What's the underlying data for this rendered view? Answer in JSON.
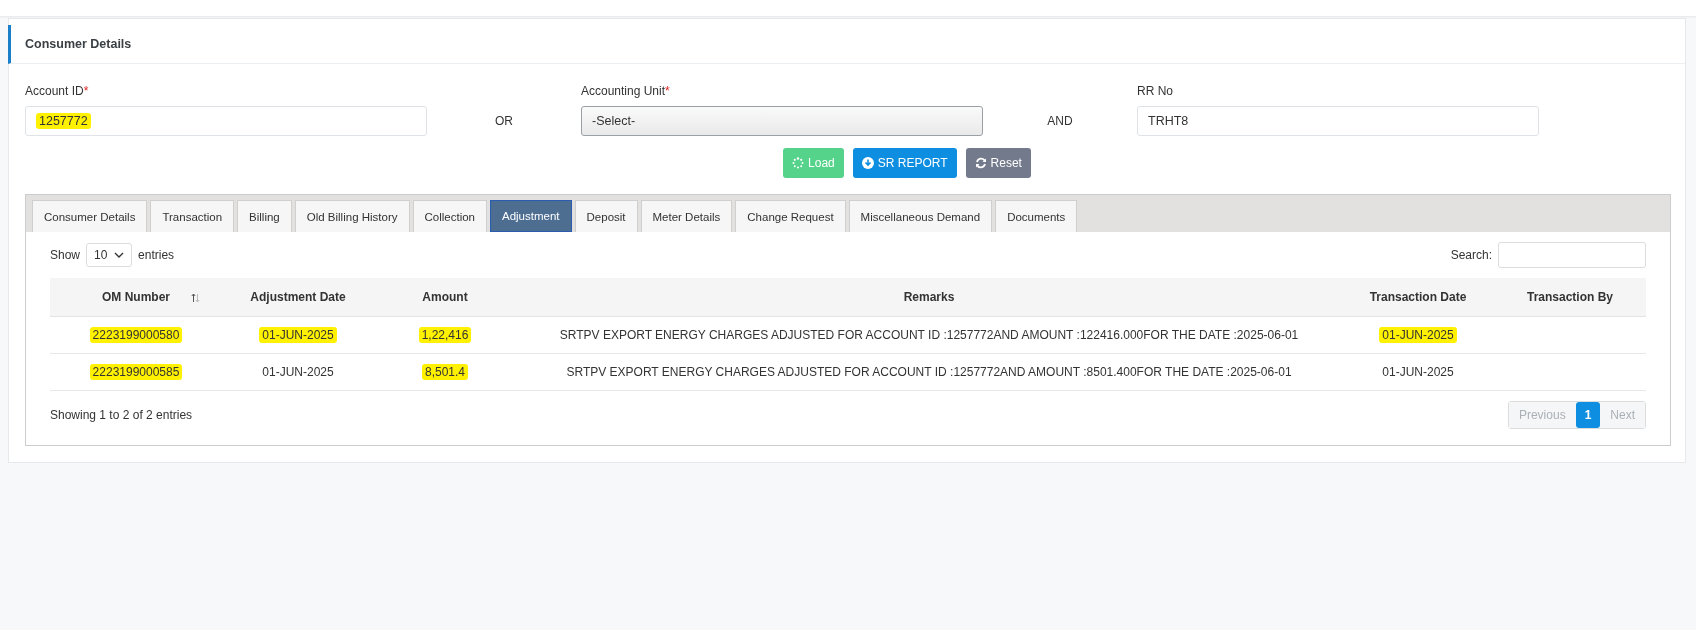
{
  "panel": {
    "title": "Consumer Details"
  },
  "fields": [
    {
      "label": "Account ID",
      "required_mark": "*",
      "kind": "input",
      "value": "1257772",
      "highlighted": true
    },
    {
      "separator": "OR"
    },
    {
      "label": "Accounting Unit",
      "required_mark": "*",
      "kind": "select",
      "value": "-Select-",
      "highlighted": false
    },
    {
      "separator": "AND"
    },
    {
      "label": "RR No",
      "kind": "input",
      "value": "TRHT8",
      "highlighted": false
    }
  ],
  "buttons": [
    {
      "label": "Load",
      "kind": "load"
    },
    {
      "label": "SR REPORT",
      "kind": "report"
    },
    {
      "label": "Reset",
      "kind": "reset"
    }
  ],
  "tabs": [
    {
      "label": "Consumer Details",
      "selected": false
    },
    {
      "label": "Transaction",
      "selected": false
    },
    {
      "label": "Billing",
      "selected": false
    },
    {
      "label": "Old Billing History",
      "selected": false
    },
    {
      "label": "Collection",
      "selected": false
    },
    {
      "label": "Adjustment",
      "selected": true
    },
    {
      "label": "Deposit",
      "selected": false
    },
    {
      "label": "Meter Details",
      "selected": false
    },
    {
      "label": "Change Request",
      "selected": false
    },
    {
      "label": "Miscellaneous Demand",
      "selected": false
    },
    {
      "label": "Documents",
      "selected": false
    }
  ],
  "length_menu": {
    "before": "Show",
    "value": "10",
    "after": "entries"
  },
  "search": {
    "label": "Search:"
  },
  "table": {
    "columns": [
      {
        "label": "OM Number",
        "sortable": true
      },
      {
        "label": "Adjustment Date",
        "sortable": false
      },
      {
        "label": "Amount",
        "sortable": false
      },
      {
        "label": "Remarks",
        "sortable": false
      },
      {
        "label": "Transaction Date",
        "sortable": false
      },
      {
        "label": "Transaction By",
        "sortable": false
      }
    ],
    "rows": [
      {
        "cells": [
          {
            "text": "2223199000580",
            "highlighted": true
          },
          {
            "text": "01-JUN-2025",
            "highlighted": true
          },
          {
            "text": "1,22,416",
            "highlighted": true
          },
          {
            "text": "SRTPV EXPORT ENERGY CHARGES ADJUSTED FOR ACCOUNT ID :1257772AND AMOUNT :122416.000FOR THE DATE :2025-06-01",
            "highlighted": false
          },
          {
            "text": "01-JUN-2025",
            "highlighted": true
          }
        ]
      },
      {
        "cells": [
          {
            "text": "2223199000585",
            "highlighted": true
          },
          {
            "text": "01-JUN-2025",
            "highlighted": false
          },
          {
            "text": "8,501.4",
            "highlighted": true
          },
          {
            "text": "SRTPV EXPORT ENERGY CHARGES ADJUSTED FOR ACCOUNT ID :1257772AND AMOUNT :8501.400FOR THE DATE :2025-06-01",
            "highlighted": false
          },
          {
            "text": "01-JUN-2025",
            "highlighted": false
          }
        ]
      }
    ]
  },
  "info": "Showing 1 to 2 of 2 entries",
  "pagination": [
    {
      "label": "Previous",
      "kind": "nav",
      "selected": false,
      "disabled": true
    },
    {
      "label": "1",
      "kind": "page",
      "selected": true,
      "disabled": false
    },
    {
      "label": "Next",
      "kind": "nav",
      "selected": false,
      "disabled": true
    }
  ]
}
